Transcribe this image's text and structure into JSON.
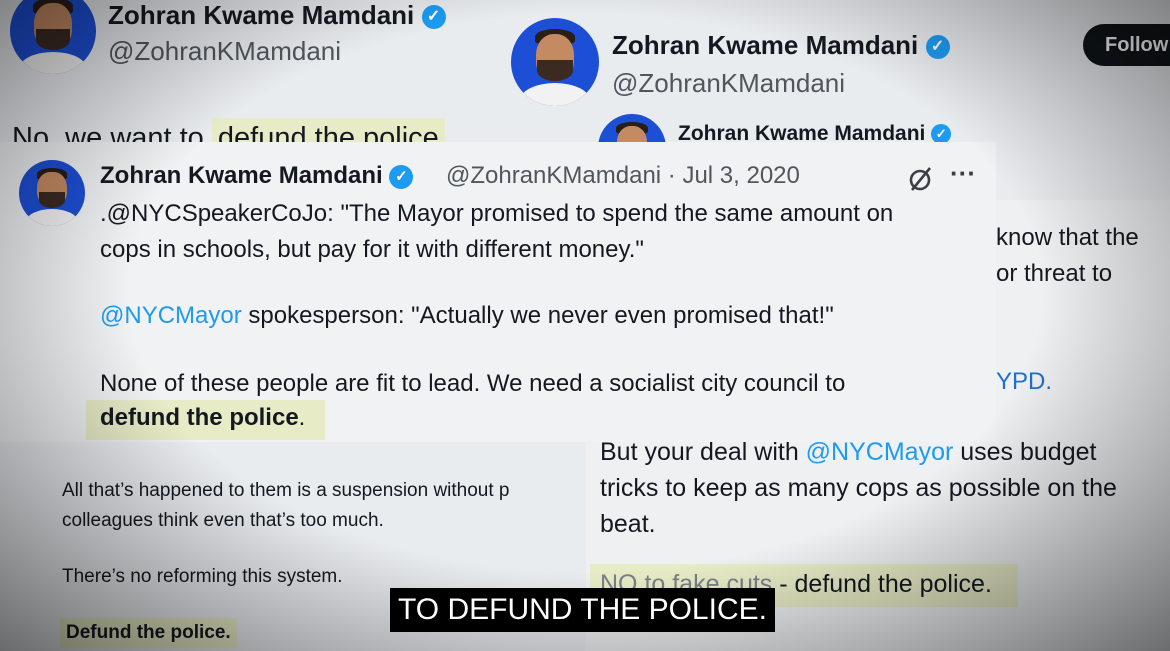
{
  "bg_card_left": {
    "name": "Zohran Kwame Mamdani",
    "handle": "@ZohranKMamdani",
    "top_text_prefix": "No, we want to ",
    "top_text_highlight": "defund the police",
    "body_line1": "All that’s happened to them is a suspension without p",
    "body_line2": "colleagues think even that’s too much.",
    "body_line3": "There’s no reforming this system.",
    "body_line4": "Defund the police."
  },
  "bg_card_right": {
    "name": "Zohran Kwame Mamdani",
    "handle": "@ZohranKMamdani",
    "follow_label": "Follow",
    "inner_name": "Zohran Kwame Mamdani",
    "side_line1": "know that the",
    "side_line2": "or threat to",
    "side_line3": "YPD.",
    "body_line1_prefix": "But your deal with ",
    "body_line1_mention": "@NYCMayor",
    "body_line1_suffix": " uses budget",
    "body_line2": "tricks to keep as many cops as possible on the",
    "body_line3": "beat.",
    "body_line4_faint": "NO to fake cuts",
    "body_line4_highlight": " - defund the police."
  },
  "main_tweet": {
    "name": "Zohran Kwame Mamdani",
    "handle": "@ZohranKMamdani",
    "date": "· Jul 3, 2020",
    "more_label": "···",
    "line1": ".@NYCSpeakerCoJo: \"The Mayor promised to spend the same amount on",
    "line2": "cops in schools, but pay for it with different money.\"",
    "line3_mention": "@NYCMayor",
    "line3_rest": " spokesperson: \"Actually we never even promised that!\"",
    "line4": "None of these people are fit to lead. We need a socialist city council to",
    "line5_highlight": "defund the police",
    "line5_end": "."
  },
  "subtitle": "TO DEFUND THE POLICE.",
  "icons": {
    "verified": "verified-badge-icon",
    "grok": "slash-circle-icon",
    "more": "more-icon"
  },
  "colors": {
    "accent": "#1d9bf0",
    "highlight": "#e8ecc6",
    "subtitle_bg": "#000000"
  }
}
